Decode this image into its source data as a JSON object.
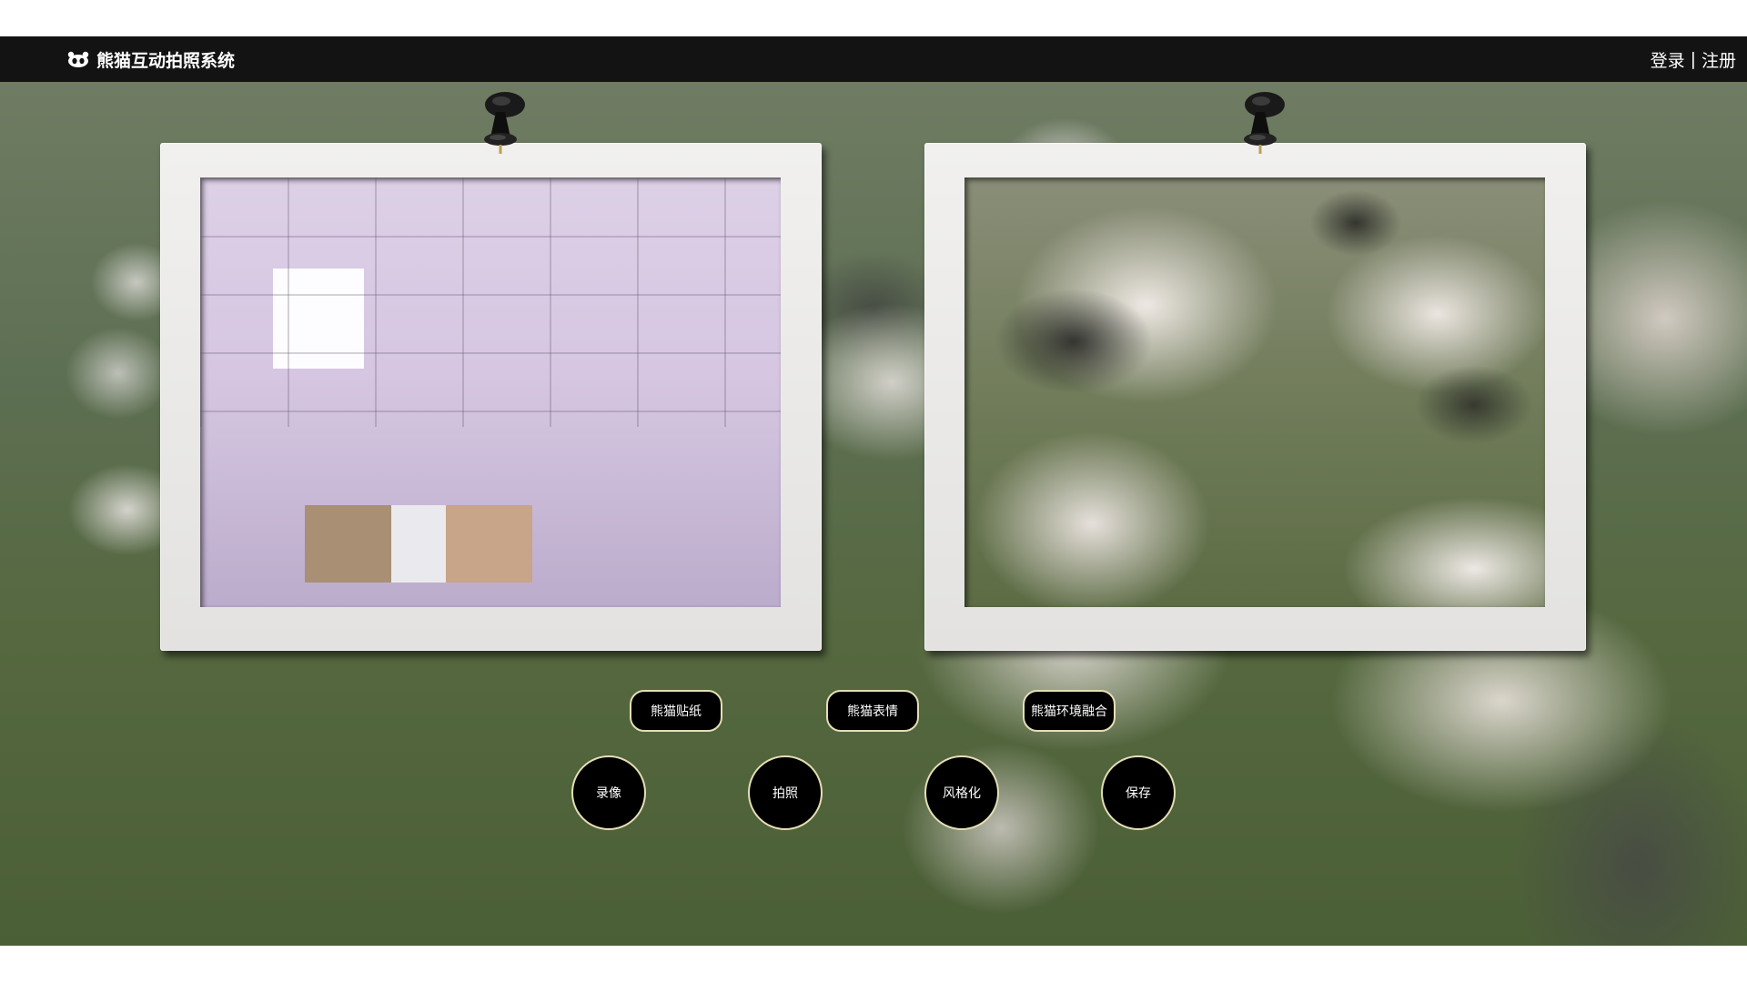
{
  "app": {
    "title": "熊猫互动拍照系统",
    "logo_icon": "panda-icon"
  },
  "auth": {
    "login_label": "登录",
    "separator": "|",
    "register_label": "注册"
  },
  "panels": {
    "camera": {
      "name": "live-camera-frame"
    },
    "preview": {
      "name": "preview-frame"
    }
  },
  "feature_buttons": [
    {
      "label": "熊猫贴纸"
    },
    {
      "label": "熊猫表情"
    },
    {
      "label": "熊猫环境融合"
    }
  ],
  "action_buttons": [
    {
      "label": "录像"
    },
    {
      "label": "拍照"
    },
    {
      "label": "风格化"
    },
    {
      "label": "保存"
    }
  ],
  "colors": {
    "topbar": "#131313",
    "button_fill": "#000000",
    "button_border": "#e5deb4",
    "frame": "#e8e7e5"
  }
}
